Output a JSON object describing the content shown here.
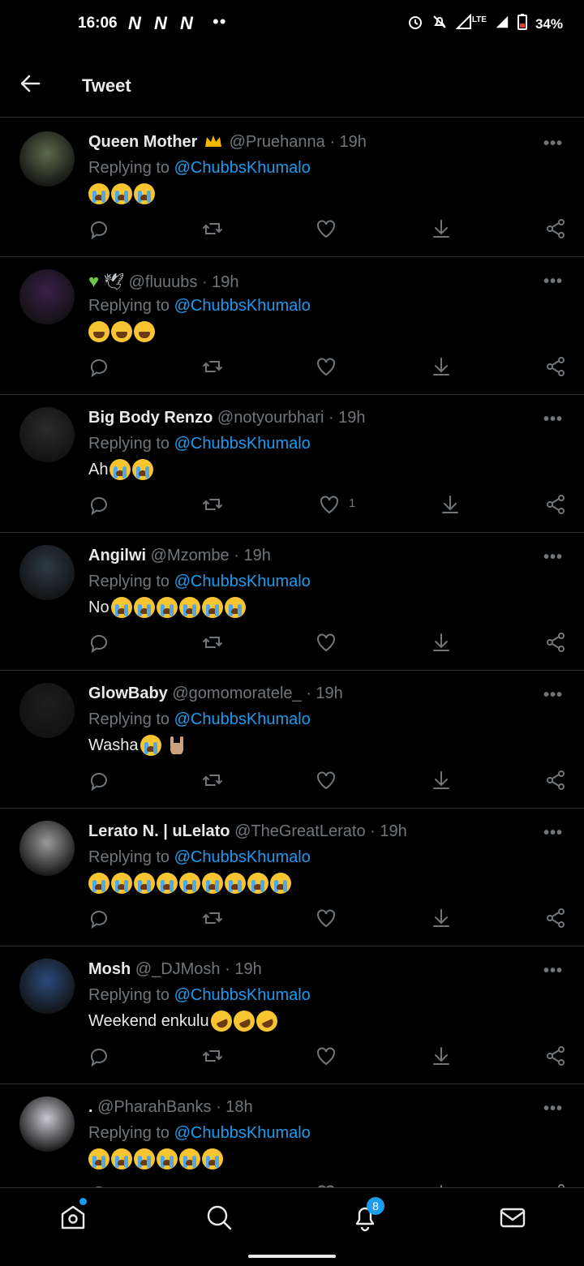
{
  "status_bar": {
    "time": "16:06",
    "network_marks": [
      "N",
      "N",
      "N"
    ],
    "dots": "••",
    "network_type": "LTE",
    "battery": "34%",
    "icons": [
      "alarm-icon",
      "mute-icon",
      "signal-icon",
      "signal-icon",
      "battery-icon"
    ]
  },
  "header": {
    "title": "Tweet",
    "back_icon": "back-arrow-icon"
  },
  "tweets": [
    {
      "name": "Queen Mother",
      "handle": "@Pruehanna",
      "time": "19h",
      "replying_prefix": "Replying to",
      "replying_to": "@ChubbsKhumalo",
      "text": "",
      "emoji": [
        "crying-face",
        "crying-face",
        "crying-face"
      ],
      "likes": ""
    },
    {
      "name": "",
      "handle": "@fluuubs",
      "time": "19h",
      "replying_prefix": "Replying to",
      "replying_to": "@ChubbsKhumalo",
      "text": "",
      "emoji": [
        "laughing-cat",
        "laughing-cat",
        "laughing-cat"
      ],
      "likes": ""
    },
    {
      "name": "Big Body Renzo",
      "handle": "@notyourbhari",
      "time": "19h",
      "replying_prefix": "Replying to",
      "replying_to": "@ChubbsKhumalo",
      "text": "Ah",
      "emoji": [
        "crying-face",
        "crying-face"
      ],
      "likes": "1"
    },
    {
      "name": "Angilwi",
      "handle": "@Mzombe",
      "time": "19h",
      "replying_prefix": "Replying to",
      "replying_to": "@ChubbsKhumalo",
      "text": "No",
      "emoji": [
        "crying-face",
        "crying-face",
        "crying-face",
        "crying-face",
        "crying-face",
        "crying-face"
      ],
      "likes": ""
    },
    {
      "name": "GlowBaby",
      "handle": "@gomomoratele_",
      "time": "19h",
      "replying_prefix": "Replying to",
      "replying_to": "@ChubbsKhumalo",
      "text": "Washa",
      "emoji": [
        "crying-face",
        "rock-hand"
      ],
      "likes": ""
    },
    {
      "name": "Lerato N. | uLelato",
      "handle": "@TheGreatLerato",
      "time": "19h",
      "replying_prefix": "Replying to",
      "replying_to": "@ChubbsKhumalo",
      "text": "",
      "emoji": [
        "crying-face",
        "crying-face",
        "crying-face",
        "crying-face",
        "crying-face",
        "crying-face",
        "crying-face",
        "crying-face",
        "crying-face"
      ],
      "likes": ""
    },
    {
      "name": "Mosh",
      "handle": "@_DJMosh",
      "time": "19h",
      "replying_prefix": "Replying to",
      "replying_to": "@ChubbsKhumalo",
      "text": "Weekend enkulu",
      "emoji": [
        "rofl-face",
        "rofl-face",
        "rofl-face"
      ],
      "likes": ""
    },
    {
      "name": ".",
      "handle": "@PharahBanks",
      "time": "18h",
      "replying_prefix": "Replying to",
      "replying_to": "@ChubbsKhumalo",
      "text": "",
      "emoji": [
        "crying-face",
        "crying-face",
        "crying-face",
        "crying-face",
        "crying-face",
        "crying-face"
      ],
      "likes": ""
    }
  ],
  "bottom_nav": {
    "items": [
      "home-icon",
      "search-icon",
      "notifications-icon",
      "messages-icon"
    ],
    "notification_badge": "8"
  },
  "colors": {
    "background": "#000000",
    "accent": "#1d9bf0",
    "muted_text": "#71767b",
    "divider": "#2f3336"
  }
}
